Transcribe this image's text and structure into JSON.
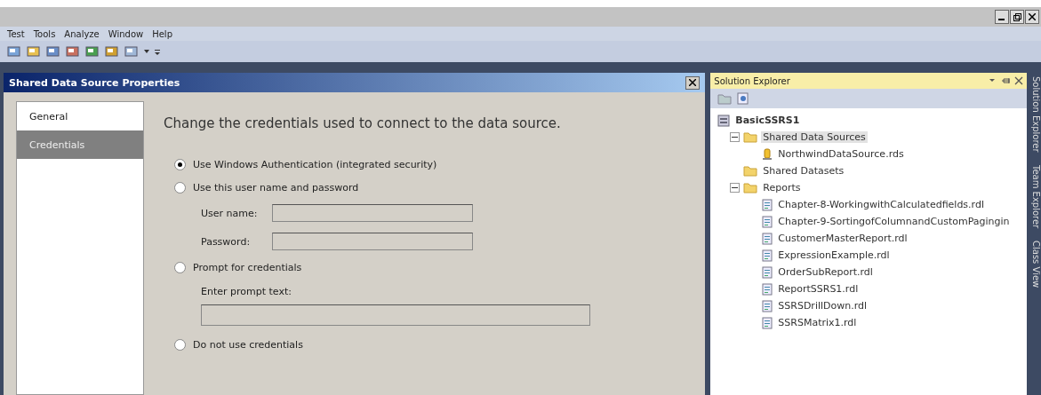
{
  "menu": [
    "Test",
    "Tools",
    "Analyze",
    "Window",
    "Help"
  ],
  "dialog": {
    "title": "Shared Data Source Properties",
    "nav": [
      {
        "label": "General",
        "selected": false
      },
      {
        "label": "Credentials",
        "selected": true
      }
    ],
    "heading": "Change the credentials used to connect to the data source.",
    "options": [
      {
        "label": "Use Windows Authentication (integrated security)",
        "selected": true
      },
      {
        "label": "Use this user name and password",
        "selected": false,
        "fields": [
          {
            "kind": "inline",
            "label": "User name:"
          },
          {
            "kind": "inline",
            "label": "Password:"
          }
        ]
      },
      {
        "label": "Prompt for credentials",
        "selected": false,
        "fields": [
          {
            "kind": "stacked",
            "label": "Enter prompt text:"
          }
        ]
      },
      {
        "label": "Do not use credentials",
        "selected": false
      }
    ]
  },
  "solution_explorer": {
    "title": "Solution Explorer",
    "tree": [
      {
        "label": "BasicSSRS1",
        "kind": "solution",
        "selected": false,
        "children": [
          {
            "label": "Shared Data Sources",
            "kind": "folder",
            "selected": true,
            "expanded": true,
            "children": [
              {
                "label": "NorthwindDataSource.rds",
                "kind": "datasource",
                "selected": false
              }
            ]
          },
          {
            "label": "Shared Datasets",
            "kind": "folder",
            "selected": false
          },
          {
            "label": "Reports",
            "kind": "folder",
            "selected": false,
            "expanded": true,
            "children": [
              {
                "label": "Chapter-8-WorkingwithCalculatedfields.rdl",
                "kind": "report",
                "selected": false
              },
              {
                "label": "Chapter-9-SortingofColumnandCustomPagingin",
                "kind": "report",
                "selected": false
              },
              {
                "label": "CustomerMasterReport.rdl",
                "kind": "report",
                "selected": false
              },
              {
                "label": "ExpressionExample.rdl",
                "kind": "report",
                "selected": false
              },
              {
                "label": "OrderSubReport.rdl",
                "kind": "report",
                "selected": false
              },
              {
                "label": "ReportSSRS1.rdl",
                "kind": "report",
                "selected": false
              },
              {
                "label": "SSRSDrillDown.rdl",
                "kind": "report",
                "selected": false
              },
              {
                "label": "SSRSMatrix1.rdl",
                "kind": "report",
                "selected": false
              }
            ]
          }
        ]
      }
    ]
  },
  "side_tabs": [
    "Solution Explorer",
    "Team Explorer",
    "Class View"
  ]
}
